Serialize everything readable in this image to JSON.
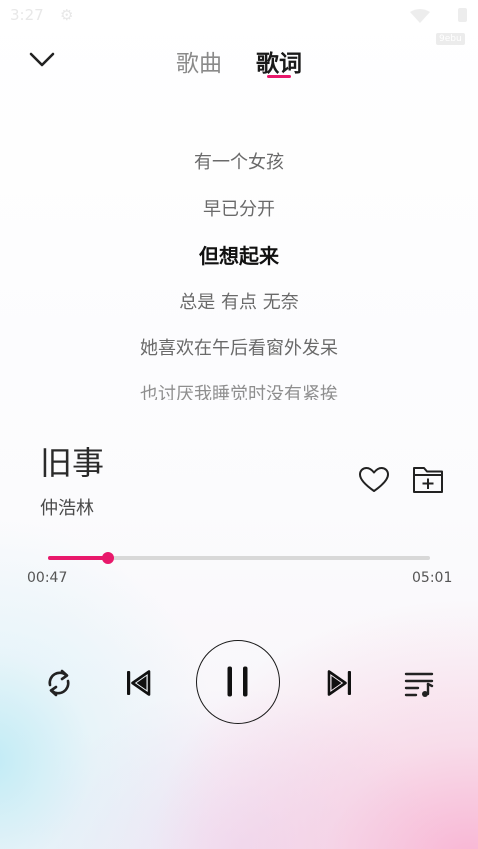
{
  "status_bar": {
    "time": "3:27",
    "gear_icon": "gear-icon",
    "wifi_icon": "wifi-icon",
    "battery_icon": "battery-icon"
  },
  "watermark": "9ebu",
  "header": {
    "back_icon": "chevron-down-icon",
    "tabs": [
      {
        "label": "歌曲",
        "active": false
      },
      {
        "label": "歌词",
        "active": true
      }
    ]
  },
  "lyrics": {
    "lines": [
      "有一个女孩",
      "早已分开",
      "但想起来",
      "总是 有点 无奈",
      "她喜欢在午后看窗外发呆",
      "也讨厌我睡觉时没有紧挨"
    ],
    "current_index": 2
  },
  "song": {
    "title": "旧事",
    "artist": "仲浩林"
  },
  "actions": {
    "like_icon": "heart-icon",
    "add_icon": "folder-add-icon"
  },
  "progress": {
    "elapsed": "00:47",
    "total": "05:01",
    "fraction": 0.156
  },
  "controls": {
    "repeat_icon": "repeat-icon",
    "prev_icon": "skip-previous-icon",
    "play_pause_icon": "pause-icon",
    "next_icon": "skip-next-icon",
    "playlist_icon": "playlist-icon"
  },
  "colors": {
    "accent": "#e8186b",
    "text_primary": "#111111",
    "text_secondary": "#6a6a6a"
  }
}
